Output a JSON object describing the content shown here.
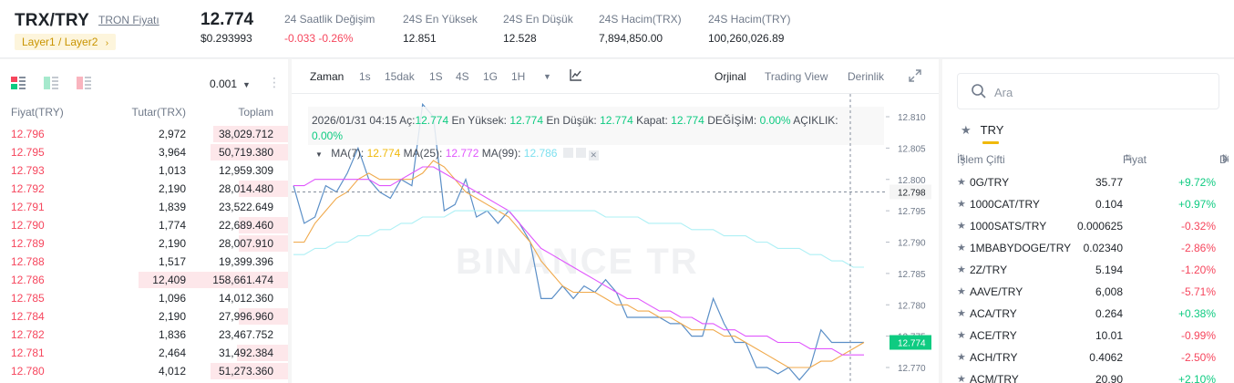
{
  "header": {
    "pair": "TRX/TRY",
    "pair_link": "TRON Fiyatı",
    "layer_badge": "Layer1 / Layer2",
    "last_price": "12.774",
    "last_price_usd": "$0.293993",
    "stats": [
      {
        "label": "24 Saatlik Değişim",
        "value": "-0.033 -0.26%",
        "color": "red"
      },
      {
        "label": "24S En Yüksek",
        "value": "12.851",
        "color": "default"
      },
      {
        "label": "24S En Düşük",
        "value": "12.528",
        "color": "default"
      },
      {
        "label": "24S Hacim(TRX)",
        "value": "7,894,850.00",
        "color": "default"
      },
      {
        "label": "24S Hacim(TRY)",
        "value": "100,260,026.89",
        "color": "default"
      }
    ]
  },
  "orderbook": {
    "precision": "0.001",
    "columns": {
      "price": "Fiyat(TRY)",
      "amount": "Tutar(TRX)",
      "total": "Toplam"
    },
    "asks": [
      {
        "price": "12.796",
        "amount": "2,972",
        "total": "38,029.712",
        "depth": 0.5
      },
      {
        "price": "12.795",
        "amount": "3,964",
        "total": "50,719.380",
        "depth": 0.52
      },
      {
        "price": "12.793",
        "amount": "1,013",
        "total": "12,959.309",
        "depth": 0
      },
      {
        "price": "12.792",
        "amount": "2,190",
        "total": "28,014.480",
        "depth": 0.33
      },
      {
        "price": "12.791",
        "amount": "1,839",
        "total": "23,522.649",
        "depth": 0
      },
      {
        "price": "12.790",
        "amount": "1,774",
        "total": "22,689.460",
        "depth": 0.33
      },
      {
        "price": "12.789",
        "amount": "2,190",
        "total": "28,007.910",
        "depth": 0.33
      },
      {
        "price": "12.788",
        "amount": "1,517",
        "total": "19,399.396",
        "depth": 0
      },
      {
        "price": "12.786",
        "amount": "12,409",
        "total": "158,661.474",
        "depth": 1
      },
      {
        "price": "12.785",
        "amount": "1,096",
        "total": "14,012.360",
        "depth": 0
      },
      {
        "price": "12.784",
        "amount": "2,190",
        "total": "27,996.960",
        "depth": 0.33
      },
      {
        "price": "12.782",
        "amount": "1,836",
        "total": "23,467.752",
        "depth": 0
      },
      {
        "price": "12.781",
        "amount": "2,464",
        "total": "31,492.384",
        "depth": 0.34
      },
      {
        "price": "12.780",
        "amount": "4,012",
        "total": "51,273.360",
        "depth": 0.52
      }
    ]
  },
  "chart": {
    "tabs": {
      "time_label": "Zaman",
      "intervals": [
        "1s",
        "15dak",
        "1S",
        "4S",
        "1G",
        "1H"
      ],
      "views": [
        "Orjinal",
        "Trading View",
        "Derinlik"
      ]
    },
    "ohlc": {
      "date": "2026/01/31 04:15",
      "open_label": "Aç:",
      "open": "12.774",
      "high_label": "En Yüksek:",
      "high": "12.774",
      "low_label": "En Düşük:",
      "low": "12.774",
      "close_label": "Kapat:",
      "close": "12.774",
      "change_label": "DEĞİŞİM:",
      "change": "0.00%",
      "amplitude_label": "AÇIKLIK:",
      "amplitude": "0.00%"
    },
    "ma": {
      "ma7_label": "MA(7):",
      "ma7": "12.774",
      "ma25_label": "MA(25):",
      "ma25": "12.772",
      "ma99_label": "MA(99):",
      "ma99": "12.786"
    },
    "watermark": "BINANCE TR",
    "crosshair_price": "12.798",
    "last_price_tag": "12.774",
    "colors": {
      "price": "#5b8fc7",
      "ma7": "#f0a94b",
      "ma25": "#e056fd",
      "ma99": "#aef0f5",
      "tag": "#0ecb81"
    }
  },
  "chart_data": {
    "type": "line",
    "ylim": [
      12.768,
      12.812
    ],
    "y_ticks": [
      "12.810",
      "12.805",
      "12.800",
      "12.795",
      "12.790",
      "12.785",
      "12.780",
      "12.775",
      "12.770"
    ],
    "series": [
      {
        "values": [
          12.799,
          12.793,
          12.794,
          12.799,
          12.798,
          12.801,
          12.805,
          12.8,
          12.798,
          12.797,
          12.8,
          12.799,
          12.812,
          12.81,
          12.795,
          12.796,
          12.8,
          12.794,
          12.795,
          12.793,
          12.795,
          12.793,
          12.79,
          12.781,
          12.781,
          12.783,
          12.781,
          12.783,
          12.782,
          12.784,
          12.782,
          12.778,
          12.778,
          12.778,
          12.778,
          12.777,
          12.777,
          12.775,
          12.775,
          12.781,
          12.777,
          12.774,
          12.774,
          12.77,
          12.77,
          12.769,
          12.77,
          12.768,
          12.77,
          12.776,
          12.774,
          12.774,
          12.774,
          12.774
        ]
      },
      {
        "name": "MA(7)",
        "values": [
          12.79,
          12.79,
          12.793,
          12.795,
          12.797,
          12.798,
          12.8,
          12.801,
          12.8,
          12.8,
          12.8,
          12.8,
          12.801,
          12.803,
          12.802,
          12.8,
          12.798,
          12.797,
          12.796,
          12.795,
          12.794,
          12.792,
          12.79,
          12.787,
          12.785,
          12.783,
          12.782,
          12.782,
          12.782,
          12.781,
          12.78,
          12.78,
          12.779,
          12.779,
          12.778,
          12.778,
          12.777,
          12.776,
          12.776,
          12.776,
          12.775,
          12.775,
          12.774,
          12.773,
          12.772,
          12.771,
          12.77,
          12.77,
          12.77,
          12.771,
          12.771,
          12.772,
          12.773,
          12.774
        ]
      },
      {
        "name": "MA(25)",
        "values": [
          12.799,
          12.799,
          12.8,
          12.8,
          12.8,
          12.8,
          12.8,
          12.8,
          12.799,
          12.799,
          12.8,
          12.801,
          12.802,
          12.802,
          12.801,
          12.8,
          12.799,
          12.798,
          12.797,
          12.796,
          12.795,
          12.793,
          12.791,
          12.789,
          12.788,
          12.787,
          12.786,
          12.785,
          12.784,
          12.783,
          12.782,
          12.781,
          12.781,
          12.78,
          12.779,
          12.779,
          12.778,
          12.778,
          12.777,
          12.777,
          12.776,
          12.776,
          12.775,
          12.775,
          12.775,
          12.774,
          12.774,
          12.774,
          12.773,
          12.773,
          12.773,
          12.772,
          12.772,
          12.772
        ]
      },
      {
        "name": "MA(99)",
        "values": [
          12.788,
          12.788,
          12.789,
          12.789,
          12.79,
          12.79,
          12.791,
          12.791,
          12.792,
          12.792,
          12.793,
          12.793,
          12.794,
          12.794,
          12.794,
          12.795,
          12.795,
          12.795,
          12.795,
          12.795,
          12.795,
          12.795,
          12.795,
          12.795,
          12.795,
          12.795,
          12.795,
          12.795,
          12.795,
          12.794,
          12.794,
          12.794,
          12.794,
          12.793,
          12.793,
          12.793,
          12.793,
          12.792,
          12.792,
          12.792,
          12.791,
          12.791,
          12.791,
          12.79,
          12.79,
          12.789,
          12.789,
          12.789,
          12.788,
          12.788,
          12.787,
          12.787,
          12.786,
          12.786
        ]
      }
    ]
  },
  "market": {
    "search_placeholder": "Ara",
    "tab_label": "TRY",
    "columns": {
      "pair": "İşlem Çifti",
      "price": "Fiyat",
      "change": "Değişim"
    },
    "rows": [
      {
        "symbol": "0G/TRY",
        "price": "35.77",
        "change": "+9.72%",
        "dir": "up"
      },
      {
        "symbol": "1000CAT/TRY",
        "price": "0.104",
        "change": "+0.97%",
        "dir": "up"
      },
      {
        "symbol": "1000SATS/TRY",
        "price": "0.000625",
        "change": "-0.32%",
        "dir": "down"
      },
      {
        "symbol": "1MBABYDOGE/TRY",
        "price": "0.02340",
        "change": "-2.86%",
        "dir": "down"
      },
      {
        "symbol": "2Z/TRY",
        "price": "5.194",
        "change": "-1.20%",
        "dir": "down"
      },
      {
        "symbol": "AAVE/TRY",
        "price": "6,008",
        "change": "-5.71%",
        "dir": "down"
      },
      {
        "symbol": "ACA/TRY",
        "price": "0.264",
        "change": "+0.38%",
        "dir": "up"
      },
      {
        "symbol": "ACE/TRY",
        "price": "10.01",
        "change": "-0.99%",
        "dir": "down"
      },
      {
        "symbol": "ACH/TRY",
        "price": "0.4062",
        "change": "-2.50%",
        "dir": "down"
      },
      {
        "symbol": "ACM/TRY",
        "price": "20.90",
        "change": "+2.10%",
        "dir": "up"
      }
    ]
  }
}
